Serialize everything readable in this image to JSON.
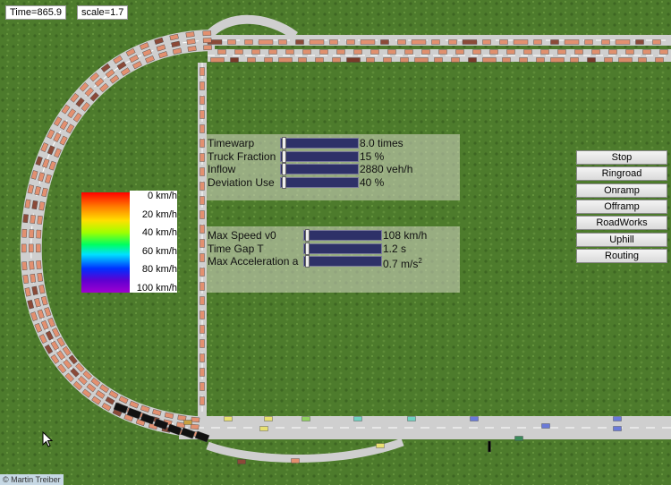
{
  "status": {
    "time": "Time=865.9",
    "scale": "scale=1.7"
  },
  "controls": {
    "sliders_top": [
      {
        "label": "Timewarp",
        "value": "8.0 times",
        "fraction": 0.03
      },
      {
        "label": "Truck Fraction",
        "value": "15 %",
        "fraction": 0.03
      },
      {
        "label": "Inflow",
        "value": "2880 veh/h",
        "fraction": 0.03
      },
      {
        "label": "Deviation Use",
        "value": "40 %",
        "fraction": 0.03
      }
    ],
    "sliders_bottom": [
      {
        "label": "Max Speed v0",
        "value": "108 km/h",
        "fraction": 0.03
      },
      {
        "label": "Time Gap T",
        "value": "1.2 s",
        "fraction": 0.03
      },
      {
        "label": "Max Acceleration a",
        "value": "0.7 m/s",
        "unit_sup": "2",
        "fraction": 0.03
      }
    ]
  },
  "buttons": [
    "Stop",
    "Ringroad",
    "Onramp",
    "Offramp",
    "RoadWorks",
    "Uphill",
    "Routing"
  ],
  "legend": {
    "labels": [
      "0 km/h",
      "20 km/h",
      "40 km/h",
      "60 km/h",
      "80 km/h",
      "100 km/h"
    ]
  },
  "footer": {
    "copyright": "© Martin Treiber"
  },
  "colors": {
    "grass": "#4a7a2a",
    "road": "#c8c8c8",
    "slider_track": "#2e3168",
    "panel": "#d7d7c8"
  }
}
